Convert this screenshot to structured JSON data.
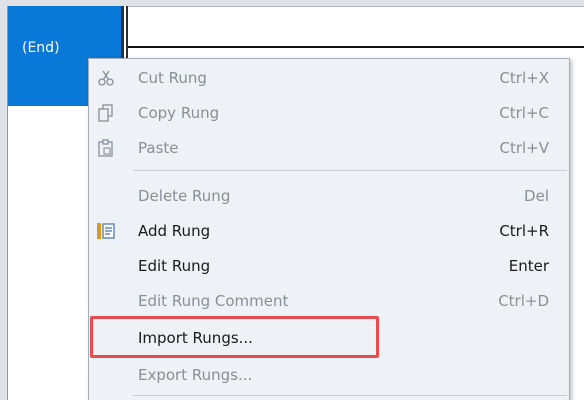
{
  "rung": {
    "label": "(End)"
  },
  "context_menu": {
    "items": [
      {
        "label": "Cut Rung",
        "shortcut": "Ctrl+X",
        "enabled": false,
        "icon": "scissors-icon"
      },
      {
        "label": "Copy Rung",
        "shortcut": "Ctrl+C",
        "enabled": false,
        "icon": "copy-icon"
      },
      {
        "label": "Paste",
        "shortcut": "Ctrl+V",
        "enabled": false,
        "icon": "paste-icon"
      },
      {
        "label": "Delete Rung",
        "shortcut": "Del",
        "enabled": false,
        "icon": ""
      },
      {
        "label": "Add Rung",
        "shortcut": "Ctrl+R",
        "enabled": true,
        "icon": "add-rung-icon"
      },
      {
        "label": "Edit Rung",
        "shortcut": "Enter",
        "enabled": true,
        "icon": ""
      },
      {
        "label": "Edit Rung Comment",
        "shortcut": "Ctrl+D",
        "enabled": false,
        "icon": ""
      },
      {
        "label": "Import Rungs...",
        "shortcut": "",
        "enabled": true,
        "icon": ""
      },
      {
        "label": "Export Rungs...",
        "shortcut": "",
        "enabled": false,
        "icon": ""
      }
    ]
  },
  "colors": {
    "selection": "#0a78d7",
    "highlight": "#e84c4c",
    "menu_bg": "#eef1f5"
  }
}
